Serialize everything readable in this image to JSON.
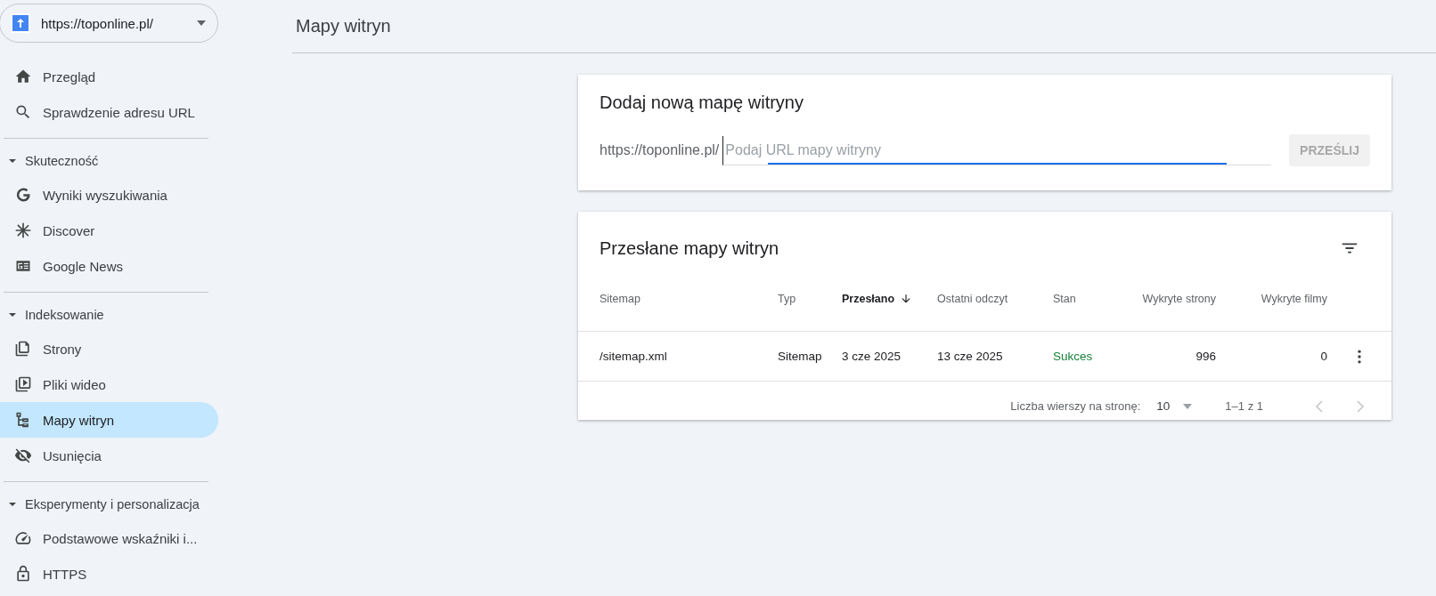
{
  "property": {
    "url": "https://toponline.pl/"
  },
  "sidebar": {
    "groups": [
      {
        "items": [
          {
            "label": "Przegląd",
            "selected": false
          },
          {
            "label": "Sprawdzenie adresu URL",
            "selected": false
          }
        ]
      },
      {
        "header": {
          "label": "Skuteczność",
          "expanded": true
        },
        "items": [
          {
            "label": "Wyniki wyszukiwania",
            "selected": false
          },
          {
            "label": "Discover",
            "selected": false
          },
          {
            "label": "Google News",
            "selected": false
          }
        ]
      },
      {
        "header": {
          "label": "Indeksowanie",
          "expanded": true
        },
        "items": [
          {
            "label": "Strony",
            "selected": false
          },
          {
            "label": "Pliki wideo",
            "selected": false
          },
          {
            "label": "Mapy witryn",
            "selected": true
          },
          {
            "label": "Usunięcia",
            "selected": false
          }
        ]
      },
      {
        "header": {
          "label": "Eksperymenty i personalizacja",
          "expanded": true
        },
        "items": [
          {
            "label": "Podstawowe wskaźniki i...",
            "selected": false
          },
          {
            "label": "HTTPS",
            "selected": false
          }
        ]
      }
    ]
  },
  "page_title": "Mapy witryn",
  "add_card": {
    "title": "Dodaj nową mapę witryny",
    "prefix": "https://toponline.pl/",
    "placeholder": "Podaj URL mapy witryny",
    "button": {
      "label": "PRZEŚLIJ",
      "disabled": true
    }
  },
  "table_card": {
    "title": "Przesłane mapy witryn",
    "columns": [
      {
        "label": "Sitemap",
        "kind": "text",
        "sorted": false
      },
      {
        "label": "Typ",
        "kind": "text",
        "sorted": false
      },
      {
        "label": "Przesłano",
        "kind": "text",
        "sorted": true
      },
      {
        "label": "Ostatni odczyt",
        "kind": "text",
        "sorted": false
      },
      {
        "label": "Stan",
        "kind": "status",
        "sorted": false
      },
      {
        "label": "Wykryte strony",
        "kind": "number",
        "sorted": false
      },
      {
        "label": "Wykryte filmy",
        "kind": "number",
        "sorted": false
      }
    ],
    "rows": [
      {
        "cells": [
          "/sitemap.xml",
          "Sitemap",
          "3 cze 2025",
          "13 cze 2025",
          "Sukces",
          "996",
          "0"
        ]
      }
    ],
    "footer": {
      "rows_label": "Liczba wierszy na stronę:",
      "rows_per_page": "10",
      "range": "1–1 z 1",
      "prev_disabled": true,
      "next_disabled": true
    }
  }
}
